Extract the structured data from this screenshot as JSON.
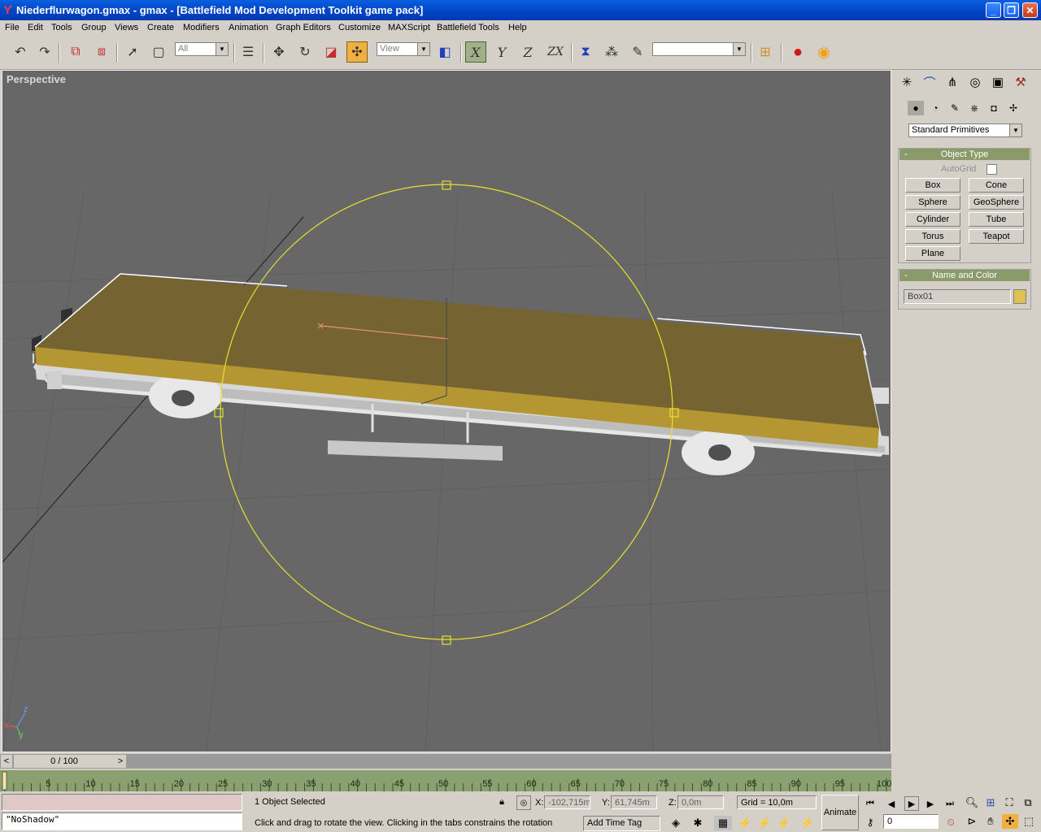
{
  "window": {
    "title": "Niederflurwagon.gmax - gmax - [Battlefield Mod Development Toolkit game pack]",
    "minimize_glyph": "_",
    "maximize_glyph": "❐",
    "close_glyph": "✕"
  },
  "menu": [
    "File",
    "Edit",
    "Tools",
    "Group",
    "Views",
    "Create",
    "Modifiers",
    "Animation",
    "Graph Editors",
    "Customize",
    "MAXScript",
    "Battlefield Tools",
    "Help"
  ],
  "toolbar": {
    "selection_filter": "All",
    "ref_coord": "View",
    "axis_x": "X",
    "axis_y": "Y",
    "axis_z": "Z",
    "axis_zx": "ZX",
    "named_selection": ""
  },
  "viewport": {
    "label": "Perspective",
    "axis_x": "x",
    "axis_y": "y",
    "axis_z": "z"
  },
  "command_panel": {
    "category": "Standard Primitives",
    "object_type_title": "Object Type",
    "autogrid_label": "AutoGrid",
    "autogrid_checked": false,
    "buttons": [
      "Box",
      "Cone",
      "Sphere",
      "GeoSphere",
      "Cylinder",
      "Tube",
      "Torus",
      "Teapot",
      "Plane"
    ],
    "name_color_title": "Name and Color",
    "object_name": "Box01",
    "object_color": "#e0c050",
    "rollout_collapse": "-"
  },
  "timeslider": {
    "label": "0 / 100",
    "current": 0,
    "total": 100,
    "prev": "<",
    "next": ">"
  },
  "track_ticks": [
    "5",
    "10",
    "15",
    "20",
    "25",
    "30",
    "35",
    "40",
    "45",
    "50",
    "55",
    "60",
    "65",
    "70",
    "75",
    "80",
    "85",
    "90",
    "95",
    "100"
  ],
  "status": {
    "maxscript_line": "",
    "maxscript_output": "\"NoShadow\"",
    "selection": "1 Object Selected",
    "prompt": "Click and drag to rotate the view.  Clicking in the tabs constrains the rotation",
    "x_label": "X:",
    "x_value": "-102,715m",
    "y_label": "Y:",
    "y_value": "61,745m",
    "z_label": "Z:",
    "z_value": "0,0m",
    "grid": "Grid = 10,0m",
    "add_time_tag": "Add Time Tag",
    "animate": "Animate",
    "frame": "0"
  },
  "colors": {
    "titlebar": "#0a5fe0",
    "viewport_bg": "#676767",
    "selection_gizmo": "#e8e030",
    "active_tool": "#f0b040"
  }
}
